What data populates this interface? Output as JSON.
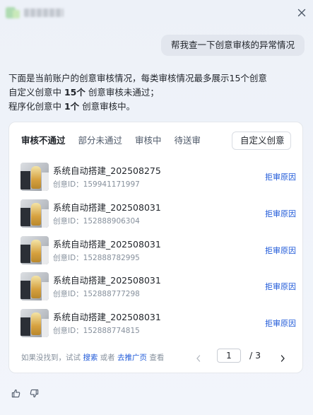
{
  "header": {
    "logo_icon": "blurred-app-logo",
    "close_icon": "close-icon"
  },
  "user_message": "帮我查一下创意审核的异常情况",
  "reply": {
    "line1": "下面是当前账户的创意审核情况，每类审核情况最多展示15个创意",
    "line2_prefix": "自定义创意中 ",
    "line2_count": "15个",
    "line2_suffix": " 创意审核未通过；",
    "line3_prefix": "程序化创意中 ",
    "line3_count": "1个",
    "line3_suffix": " 创意审核中。"
  },
  "card": {
    "tabs": [
      {
        "label": "审核不通过",
        "active": true
      },
      {
        "label": "部分未通过",
        "active": false
      },
      {
        "label": "审核中",
        "active": false
      },
      {
        "label": "待送审",
        "active": false
      }
    ],
    "filter_select": {
      "value": "自定义创意",
      "icon": "chevron-down-icon"
    },
    "items": [
      {
        "name": "系统自动搭建_202508275",
        "id": "创意ID：159941171997",
        "action": "拒审原因"
      },
      {
        "name": "系统自动搭建_202508031",
        "id": "创意ID：152888906304",
        "action": "拒审原因"
      },
      {
        "name": "系统自动搭建_202508031",
        "id": "创意ID：152888782995",
        "action": "拒审原因"
      },
      {
        "name": "系统自动搭建_202508031",
        "id": "创意ID：152888777298",
        "action": "拒审原因"
      },
      {
        "name": "系统自动搭建_202508031",
        "id": "创意ID：152888774815",
        "action": "拒审原因"
      }
    ],
    "footer": {
      "hint_prefix": "如果没找到，试试 ",
      "search_link": "搜索",
      "hint_mid": " 或者 ",
      "promo_link": "去推广页",
      "hint_suffix": " 查看"
    },
    "pagination": {
      "current_page": "1",
      "total_text": "/  3"
    }
  },
  "feedback": {
    "like_icon": "thumbs-up-icon",
    "dislike_icon": "thumbs-down-icon"
  }
}
